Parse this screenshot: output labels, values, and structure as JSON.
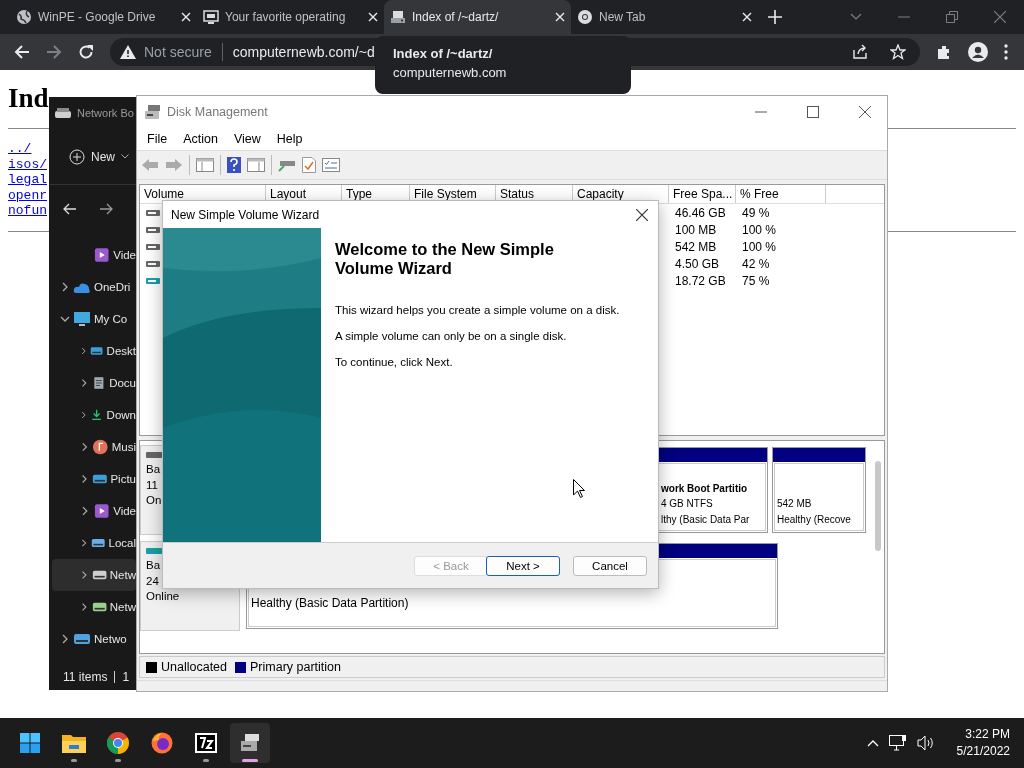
{
  "browser": {
    "tabs": [
      {
        "title": "WinPE - Google Drive",
        "kind": "globe",
        "selected": false
      },
      {
        "title": "Your favorite operating",
        "kind": "monitor",
        "selected": false
      },
      {
        "title": "Index of /~dartz/",
        "kind": "disk",
        "selected": true
      },
      {
        "title": "New Tab",
        "kind": "chrome",
        "selected": false
      }
    ],
    "security": "Not secure",
    "url": "computernewb.com/~d",
    "tooltip": {
      "title": "Index of /~dartz/",
      "url": "computernewb.com"
    }
  },
  "page": {
    "heading": "Ind",
    "links": [
      "../",
      "isos/",
      "legal",
      "openr",
      "nofun"
    ]
  },
  "explorer": {
    "title": "Network Bo",
    "new_button": "New",
    "nav_top": [
      {
        "label": "Vide",
        "kind": "video",
        "selected": false
      }
    ],
    "nav": [
      {
        "label": "OneDri",
        "kind": "cloud",
        "expanded": false,
        "selected": false
      },
      {
        "label": "My Co",
        "kind": "pc",
        "expanded": true,
        "selected": false,
        "children": [
          {
            "label": "Deskt",
            "kind": "desktop",
            "expanded": false,
            "selected": false
          },
          {
            "label": "Docu",
            "kind": "docs",
            "expanded": false,
            "selected": false
          },
          {
            "label": "Down",
            "kind": "download",
            "expanded": false,
            "selected": false
          },
          {
            "label": "Musi",
            "kind": "music",
            "expanded": false,
            "selected": false
          },
          {
            "label": "Pictu",
            "kind": "pictures",
            "expanded": false,
            "selected": false
          },
          {
            "label": "Vide",
            "kind": "video",
            "expanded": false,
            "selected": false
          },
          {
            "label": "Local",
            "kind": "drive",
            "expanded": false,
            "selected": false
          },
          {
            "label": "Netw",
            "kind": "netdrive",
            "expanded": false,
            "selected": true
          },
          {
            "label": "Netw",
            "kind": "netdrive2",
            "expanded": false,
            "selected": false
          }
        ]
      },
      {
        "label": "Netwo",
        "kind": "network",
        "expanded": false,
        "selected": false
      }
    ],
    "status": [
      "11 items",
      "1"
    ]
  },
  "disk_management": {
    "title": "Disk Management",
    "menu": [
      "File",
      "Action",
      "View",
      "Help"
    ],
    "columns": [
      "Volume",
      "Layout",
      "Type",
      "File System",
      "Status",
      "Capacity",
      "Free Spa...",
      "% Free"
    ],
    "rows": [
      {
        "kind": "drive",
        "free": "46.46 GB",
        "pct_free": "49 %"
      },
      {
        "kind": "drive",
        "free": "100 MB",
        "pct_free": "100 %"
      },
      {
        "kind": "drive",
        "free": "542 MB",
        "pct_free": "100 %"
      },
      {
        "kind": "drive",
        "free": "4.50 GB",
        "pct_free": "42 %"
      },
      {
        "kind": "usb",
        "free": "18.72 GB",
        "pct_free": "75 %"
      }
    ],
    "disks": [
      {
        "kind": "drive",
        "lines": [
          "Ba",
          "11",
          "On"
        ],
        "partitions": [
          {
            "lines": [
              "work Boot Partitio",
              "4 GB NTFS",
              "lthy (Basic Data Par"
            ]
          },
          {
            "lines": [
              "542 MB",
              "Healthy (Recove"
            ]
          }
        ]
      },
      {
        "kind": "usb",
        "lines": [
          "Ba",
          "24",
          "Online"
        ],
        "partitions": [
          {
            "lines": [
              "Healthy (Basic Data Partition)"
            ]
          }
        ]
      }
    ],
    "legend": [
      {
        "label": "Unallocated",
        "color": "#000000"
      },
      {
        "label": "Primary partition",
        "color": "#000080"
      }
    ]
  },
  "wizard": {
    "title": "New Simple Volume Wizard",
    "heading": "Welcome to the New Simple Volume Wizard",
    "paragraphs": [
      "This wizard helps you create a simple volume on a disk.",
      "A simple volume can only be on a single disk.",
      "To continue, click Next."
    ],
    "buttons": [
      {
        "label": "< Back",
        "disabled": true,
        "default": false
      },
      {
        "label": "Next >",
        "disabled": false,
        "default": true
      },
      {
        "label": "Cancel",
        "disabled": false,
        "default": false
      }
    ]
  },
  "taskbar": {
    "apps": [
      {
        "kind": "start",
        "running": false,
        "selected": false
      },
      {
        "kind": "folder",
        "running": true,
        "selected": false
      },
      {
        "kind": "chrome",
        "running": true,
        "selected": false
      },
      {
        "kind": "firefox",
        "running": false,
        "selected": false
      },
      {
        "kind": "archive",
        "running": true,
        "selected": false
      },
      {
        "kind": "diskmgmt",
        "running": true,
        "selected": true
      }
    ],
    "time": "3:22 PM",
    "date": "5/21/2022"
  }
}
